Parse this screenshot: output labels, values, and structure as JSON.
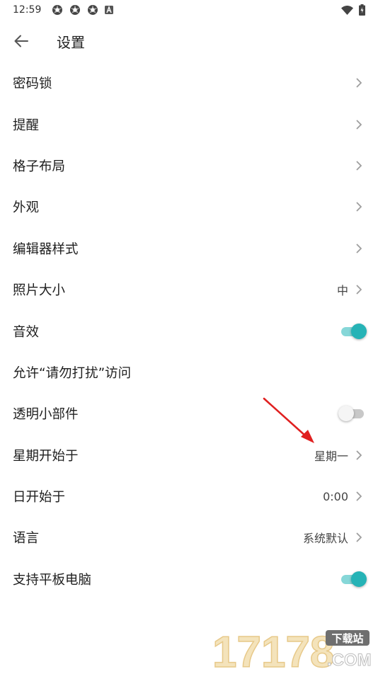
{
  "status_bar": {
    "time": "12:59",
    "icons": [
      "app-notification-icon",
      "app-notification-icon",
      "app-notification-icon",
      "a-badge-icon"
    ],
    "right_icons": [
      "wifi-icon",
      "battery-icon"
    ]
  },
  "app_bar": {
    "title": "设置",
    "back_icon": "arrow-left-icon"
  },
  "accent_color": "#26b3b6",
  "settings": [
    {
      "label": "密码锁",
      "value": "",
      "control": "chevron"
    },
    {
      "label": "提醒",
      "value": "",
      "control": "chevron"
    },
    {
      "label": "格子布局",
      "value": "",
      "control": "chevron"
    },
    {
      "label": "外观",
      "value": "",
      "control": "chevron"
    },
    {
      "label": "编辑器样式",
      "value": "",
      "control": "chevron"
    },
    {
      "label": "照片大小",
      "value": "中",
      "control": "chevron"
    },
    {
      "label": "音效",
      "value": "",
      "control": "toggle",
      "on": true
    },
    {
      "label": "允许“请勿打扰”访问",
      "value": "",
      "control": "none"
    },
    {
      "label": "透明小部件",
      "value": "",
      "control": "toggle",
      "on": false
    },
    {
      "label": "星期开始于",
      "value": "星期一",
      "control": "chevron"
    },
    {
      "label": "日开始于",
      "value": "0:00",
      "control": "chevron"
    },
    {
      "label": "语言",
      "value": "系统默认",
      "control": "chevron"
    },
    {
      "label": "支持平板电脑",
      "value": "",
      "control": "toggle",
      "on": true
    }
  ],
  "watermark": {
    "number": "17178",
    "badge": "下载站",
    "suffix": ".COM"
  }
}
